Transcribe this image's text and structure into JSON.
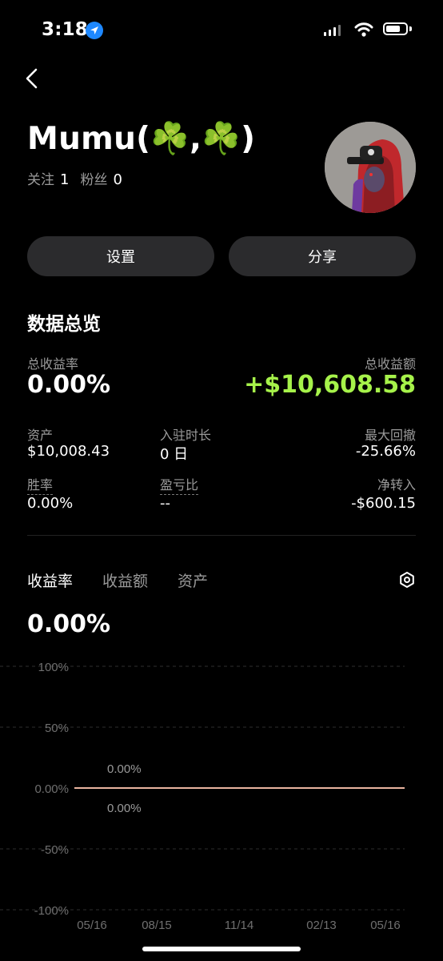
{
  "status_bar": {
    "time": "3:18"
  },
  "profile": {
    "name": "Mumu(☘️,☘️)",
    "following_label": "关注",
    "following_count": "1",
    "followers_label": "粉丝",
    "followers_count": "0"
  },
  "actions": {
    "settings_label": "设置",
    "share_label": "分享"
  },
  "overview": {
    "title": "数据总览",
    "total_return_rate_label": "总收益率",
    "total_return_rate": "0.00%",
    "total_return_amount_label": "总收益额",
    "total_return_amount": "+$10,608.58",
    "assets_label": "资产",
    "assets": "$10,008.43",
    "tenure_label": "入驻时长",
    "tenure": "0 日",
    "max_drawdown_label": "最大回撤",
    "max_drawdown": "-25.66%",
    "win_rate_label": "胜率",
    "win_rate": "0.00%",
    "pl_ratio_label": "盈亏比",
    "pl_ratio": "--",
    "net_transfer_label": "净转入",
    "net_transfer": "-$600.15"
  },
  "tabs": [
    {
      "label": "收益率",
      "active": true
    },
    {
      "label": "收益额",
      "active": false
    },
    {
      "label": "资产",
      "active": false
    }
  ],
  "chart_value": "0.00%",
  "chart_data": {
    "type": "line",
    "x_tick_labels": [
      "05/16",
      "08/15",
      "11/14",
      "02/13",
      "05/16"
    ],
    "y_tick_labels": [
      "100%",
      "50%",
      "0.00%",
      "-50%",
      "-100%"
    ],
    "ylim": [
      -100,
      100
    ],
    "series": [
      {
        "values": [
          0,
          0,
          0,
          0,
          0
        ],
        "color": "#e8b4a0"
      }
    ],
    "annotations": {
      "max_label": "0.00%",
      "min_label": "0.00%"
    },
    "grid": true
  }
}
